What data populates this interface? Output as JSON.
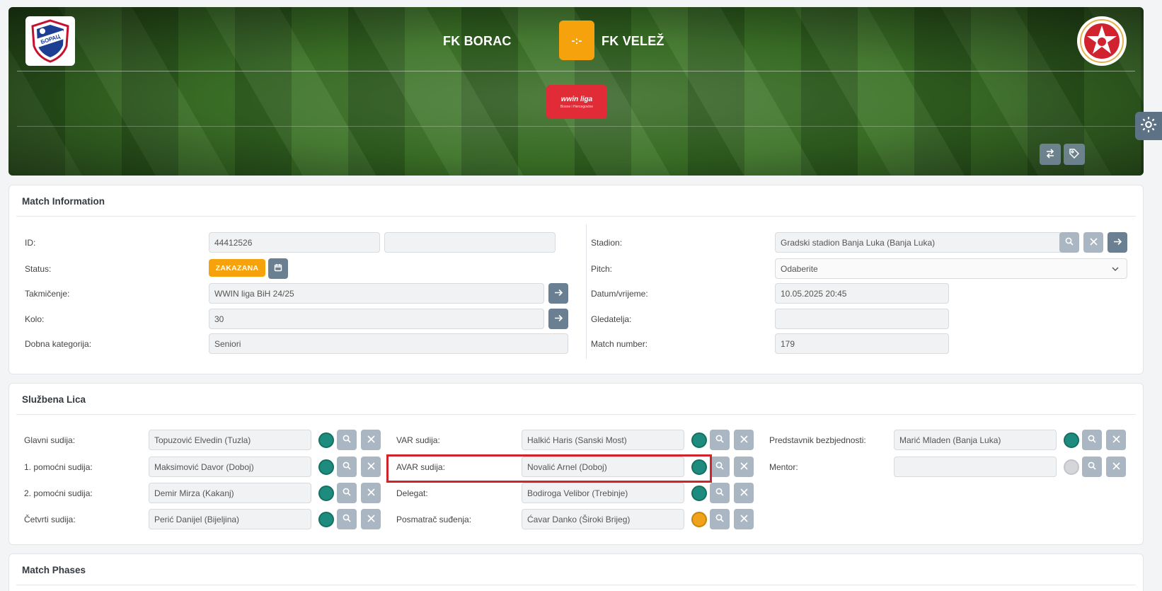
{
  "header": {
    "home_team": "FK BORAC",
    "away_team": "FK VELEŽ",
    "score": "-:-",
    "league_logo_text": "wwin liga",
    "league_logo_subtext": "Bosne i Hercegovine"
  },
  "match_info": {
    "title": "Match Information",
    "id_label": "ID:",
    "id_value": "44412526",
    "id_extra_value": "",
    "status_label": "Status:",
    "status_badge": "ZAKAZANA",
    "competition_label": "Takmičenje:",
    "competition_value": "WWIN liga BiH 24/25",
    "round_label": "Kolo:",
    "round_value": "30",
    "age_label": "Dobna kategorija:",
    "age_value": "Seniori",
    "stadium_label": "Stadion:",
    "stadium_value": "Gradski stadion Banja Luka (Banja Luka)",
    "pitch_label": "Pitch:",
    "pitch_value": "Odaberite",
    "datetime_label": "Datum/vrijeme:",
    "datetime_value": "10.05.2025 20:45",
    "spectators_label": "Gledatelja:",
    "spectators_value": "",
    "match_number_label": "Match number:",
    "match_number_value": "179"
  },
  "officials": {
    "title": "Službena Lica",
    "col1": [
      {
        "label": "Glavni sudija:",
        "value": "Topuzović Elvedin (Tuzla)",
        "status": "teal"
      },
      {
        "label": "1. pomoćni sudija:",
        "value": "Maksimović Davor (Doboj)",
        "status": "teal"
      },
      {
        "label": "2. pomoćni sudija:",
        "value": "Demir Mirza (Kakanj)",
        "status": "teal"
      },
      {
        "label": "Četvrti sudija:",
        "value": "Perić Danijel (Bijeljina)",
        "status": "teal"
      }
    ],
    "col2": [
      {
        "label": "VAR sudija:",
        "value": "Halkić Haris (Sanski Most)",
        "status": "teal"
      },
      {
        "label": "AVAR sudija:",
        "value": "Novalić Arnel (Doboj)",
        "status": "teal"
      },
      {
        "label": "Delegat:",
        "value": "Bodiroga Velibor (Trebinje)",
        "status": "teal"
      },
      {
        "label": "Posmatrač suđenja:",
        "value": "Ćavar Danko (Široki Brijeg)",
        "status": "orange"
      }
    ],
    "col3": [
      {
        "label": "Predstavnik bezbjednosti:",
        "value": "Marić Mladen (Banja Luka)",
        "status": "teal"
      },
      {
        "label": "Mentor:",
        "value": "",
        "status": "grey"
      }
    ]
  },
  "phases": {
    "title": "Match Phases"
  },
  "colors": {
    "accent_orange": "#f5a20c",
    "status_teal": "#1d8c7e",
    "status_orange": "#f0a21a",
    "highlight_red": "#d1232a",
    "league_red": "#e12b37"
  },
  "icons": {
    "search": "search-icon",
    "clear": "close-icon",
    "go": "arrow-right-icon",
    "calendar": "calendar-icon",
    "swap": "swap-icon",
    "tag": "tag-icon",
    "settings": "gear-icon"
  }
}
